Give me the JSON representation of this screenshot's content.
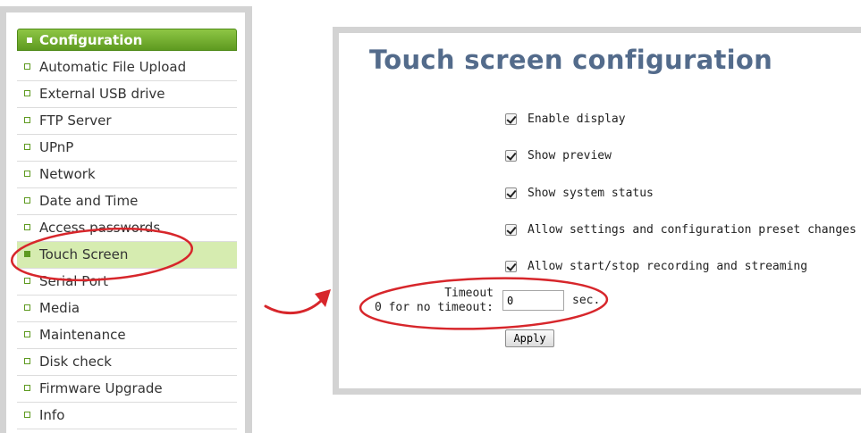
{
  "menu": {
    "header": "Configuration",
    "items": [
      {
        "label": "Automatic File Upload",
        "active": false
      },
      {
        "label": "External USB drive",
        "active": false
      },
      {
        "label": "FTP Server",
        "active": false
      },
      {
        "label": "UPnP",
        "active": false
      },
      {
        "label": "Network",
        "active": false
      },
      {
        "label": "Date and Time",
        "active": false
      },
      {
        "label": "Access passwords",
        "active": false
      },
      {
        "label": "Touch Screen",
        "active": true
      },
      {
        "label": "Serial Port",
        "active": false
      },
      {
        "label": "Media",
        "active": false
      },
      {
        "label": "Maintenance",
        "active": false
      },
      {
        "label": "Disk check",
        "active": false
      },
      {
        "label": "Firmware Upgrade",
        "active": false
      },
      {
        "label": "Info",
        "active": false
      }
    ]
  },
  "config": {
    "title": "Touch screen configuration",
    "options": [
      {
        "label": "Enable display",
        "checked": true
      },
      {
        "label": "Show preview",
        "checked": true
      },
      {
        "label": "Show system status",
        "checked": true
      },
      {
        "label": "Allow settings and configuration preset changes",
        "checked": true
      },
      {
        "label": "Allow start/stop recording and streaming",
        "checked": true
      }
    ],
    "timeout": {
      "label_line1": "Timeout",
      "label_line2": "0 for no timeout:",
      "value": "0",
      "unit": "sec."
    },
    "apply_label": "Apply"
  },
  "colors": {
    "annotation": "#d7262b",
    "menu_header": "#6aa629",
    "active_item_bg": "#d6ecb0",
    "title": "#536b8b",
    "panel_border": "#d3d3d3"
  }
}
